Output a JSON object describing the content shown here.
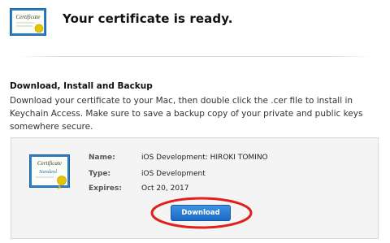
{
  "header": {
    "title": "Your certificate is ready.",
    "icon": "certificate-icon",
    "icon_text": "Certificate"
  },
  "section": {
    "heading": "Download, Install and Backup",
    "body": "Download your certificate to your Mac, then double click the .cer file to install in Keychain Access. Make sure to save a backup copy of your private and public keys somewhere secure."
  },
  "certificate": {
    "icon": "certificate-standard-icon",
    "icon_text_top": "Certificate",
    "icon_text_bottom": "Standard",
    "name_label": "Name:",
    "name_value": "iOS Development: HIROKI TOMINO",
    "type_label": "Type:",
    "type_value": "iOS Development",
    "expires_label": "Expires:",
    "expires_value": "Oct 20, 2017"
  },
  "actions": {
    "download_label": "Download"
  },
  "colors": {
    "button": "#1f6fc9",
    "highlight": "#e0201c",
    "box_background": "#f4f4f4"
  }
}
